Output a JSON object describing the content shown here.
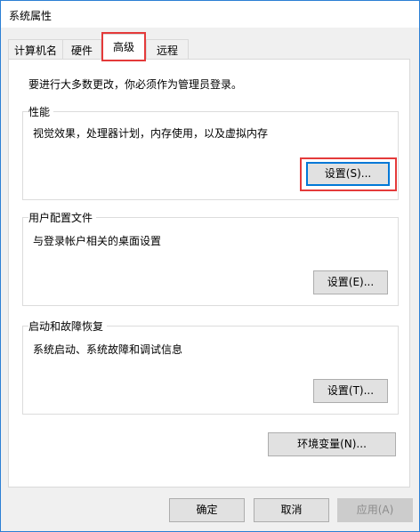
{
  "window": {
    "title": "系统属性"
  },
  "tabs": [
    {
      "label": "计算机名"
    },
    {
      "label": "硬件"
    },
    {
      "label": "高级"
    },
    {
      "label": "远程"
    }
  ],
  "active_tab": "高级",
  "intro_text": "要进行大多数更改，你必须作为管理员登录。",
  "groups": {
    "performance": {
      "title": "性能",
      "description": "视觉效果，处理器计划，内存使用，以及虚拟内存",
      "button_label": "设置(S)..."
    },
    "user_profiles": {
      "title": "用户配置文件",
      "description": "与登录帐户相关的桌面设置",
      "button_label": "设置(E)..."
    },
    "startup_recovery": {
      "title": "启动和故障恢复",
      "description": "系统启动、系统故障和调试信息",
      "button_label": "设置(T)..."
    }
  },
  "env_button_label": "环境变量(N)...",
  "footer": {
    "ok_label": "确定",
    "cancel_label": "取消",
    "apply_label": "应用(A)"
  },
  "colors": {
    "highlight": "#e43a3a",
    "window_border": "#2b7fd4",
    "focus_border": "#0078d7"
  }
}
